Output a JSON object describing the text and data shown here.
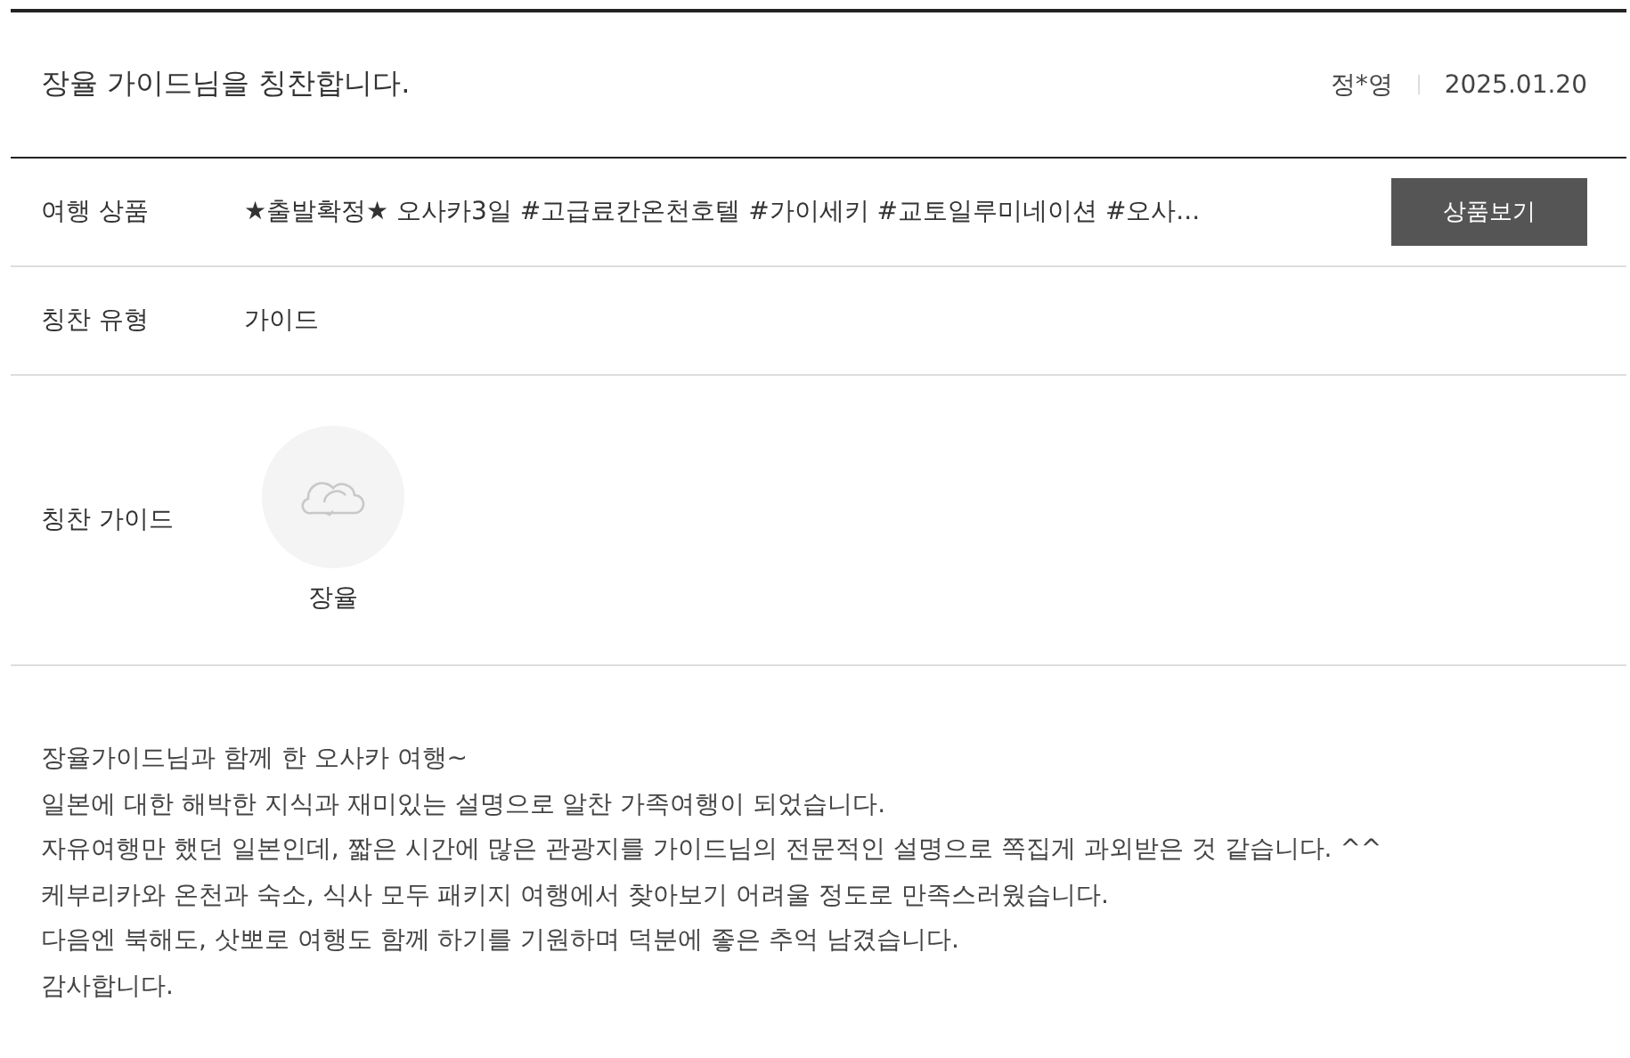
{
  "header": {
    "title": "장율 가이드님을 칭찬합니다.",
    "author": "정*영",
    "date": "2025.01.20"
  },
  "rows": [
    {
      "kind": "product",
      "label": "여행 상품",
      "value": "★출발확정★ 오사카3일 #고급료칸온천호텔 #가이세키 #교토일루미네이션 #오사...",
      "button": "상품보기"
    },
    {
      "kind": "text",
      "label": "칭찬 유형",
      "value": "가이드"
    },
    {
      "kind": "guide",
      "label": "칭찬 가이드",
      "value": "장율"
    }
  ],
  "body": [
    "장율가이드님과 함께 한 오사카 여행~",
    "일본에 대한 해박한 지식과 재미있는 설명으로 알찬 가족여행이 되었습니다.",
    "자유여행만 했던 일본인데, 짧은 시간에 많은 관광지를 가이드님의 전문적인 설명으로 쪽집게 과외받은 것 같습니다. ^^",
    "케부리카와 온천과 숙소, 식사 모두 패키지 여행에서 찾아보기 어려울 정도로 만족스러웠습니다.",
    "다음엔 북해도, 삿뽀로 여행도 함께 하기를 기원하며 덕분에 좋은 추억 남겼습니다.",
    "감사합니다."
  ]
}
